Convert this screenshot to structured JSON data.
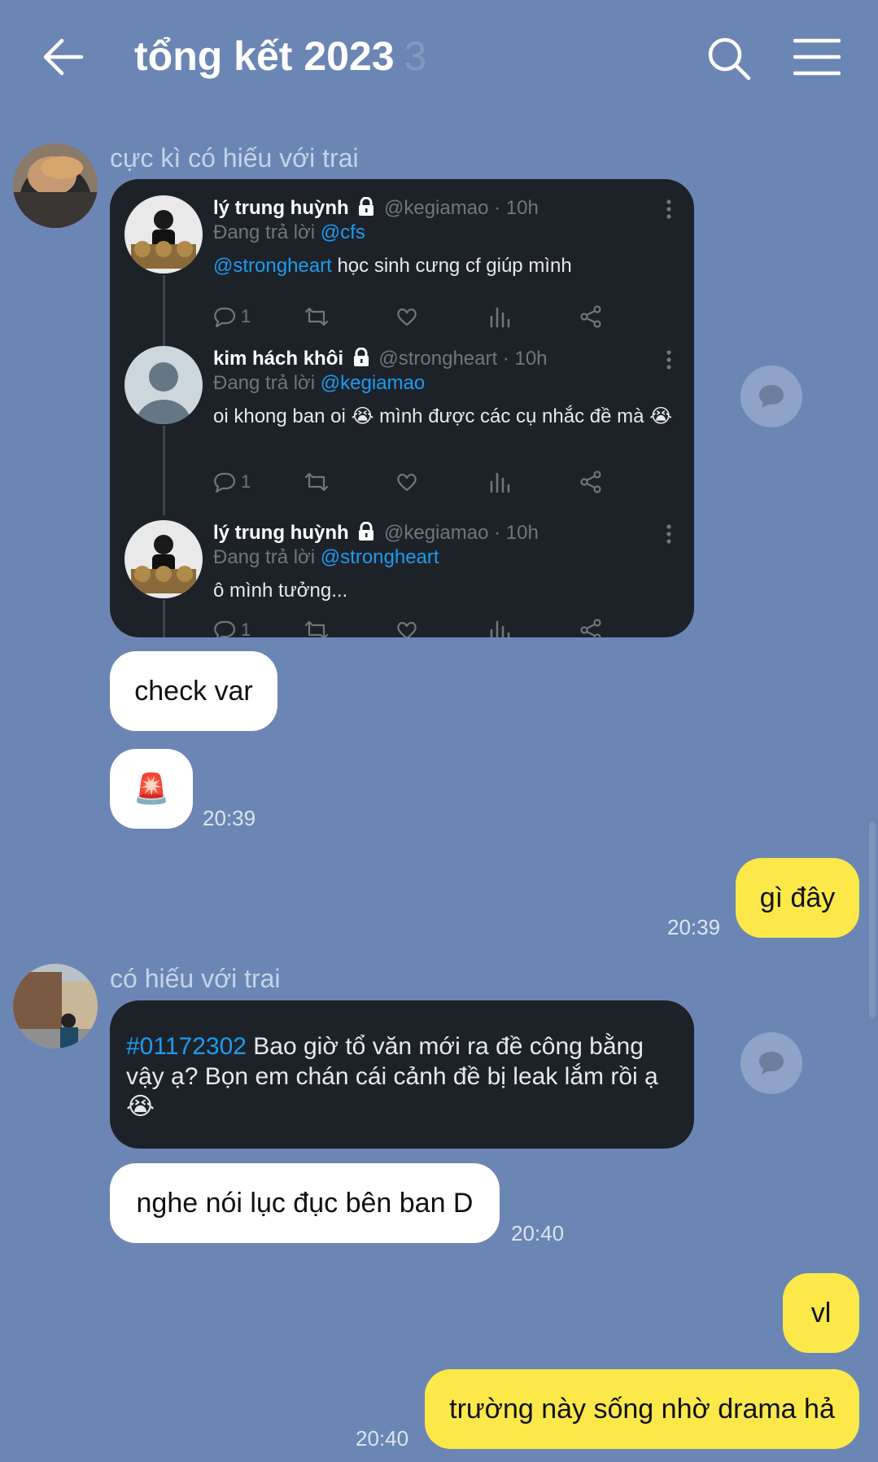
{
  "header": {
    "title": "tổng kết 2023",
    "member_count": "3",
    "back_icon": "arrow-left-icon",
    "search_icon": "search-icon",
    "menu_icon": "hamburger-menu-icon"
  },
  "messages": [
    {
      "sender": "cực kì có hiếu với trai",
      "tweets": [
        {
          "name": "lý trung huỳnh",
          "handle": "@kegiamao · 10h",
          "reply_prefix": "Đang trả lời",
          "reply_to": "@cfs",
          "mention": "@strongheart",
          "text": " học sinh cưng cf giúp mình",
          "reply_count": "1"
        },
        {
          "name": "kim hách khôi",
          "handle": "@strongheart · 10h",
          "reply_prefix": "Đang trả lời",
          "reply_to": "@kegiamao",
          "text": "oi khong ban oi 😭 mình được các cụ nhắc đề mà 😭",
          "reply_count": "1"
        },
        {
          "name": "lý trung huỳnh",
          "handle": "@kegiamao · 10h",
          "reply_prefix": "Đang trả lời",
          "reply_to": "@strongheart",
          "text": "ô mình tưởng...",
          "reply_count": "1"
        }
      ],
      "bubble_1": "check var",
      "bubble_2": "🚨",
      "time": "20:39"
    },
    {
      "mine": true,
      "text": "gì đây",
      "time": "20:39"
    },
    {
      "sender": "có hiếu với trai",
      "hashtag": "#01172302",
      "post_text": " Bao giờ tổ văn mới ra đề công bằng vậy ạ? Bọn em chán cái cảnh đề bị leak lắm rồi ạ 😭",
      "bubble": "nghe nói lục đục bên ban D",
      "time": "20:40"
    },
    {
      "mine": true,
      "bubble_1": "vl",
      "bubble_2": "trường này sống nhờ drama hả",
      "time": "20:40"
    }
  ]
}
